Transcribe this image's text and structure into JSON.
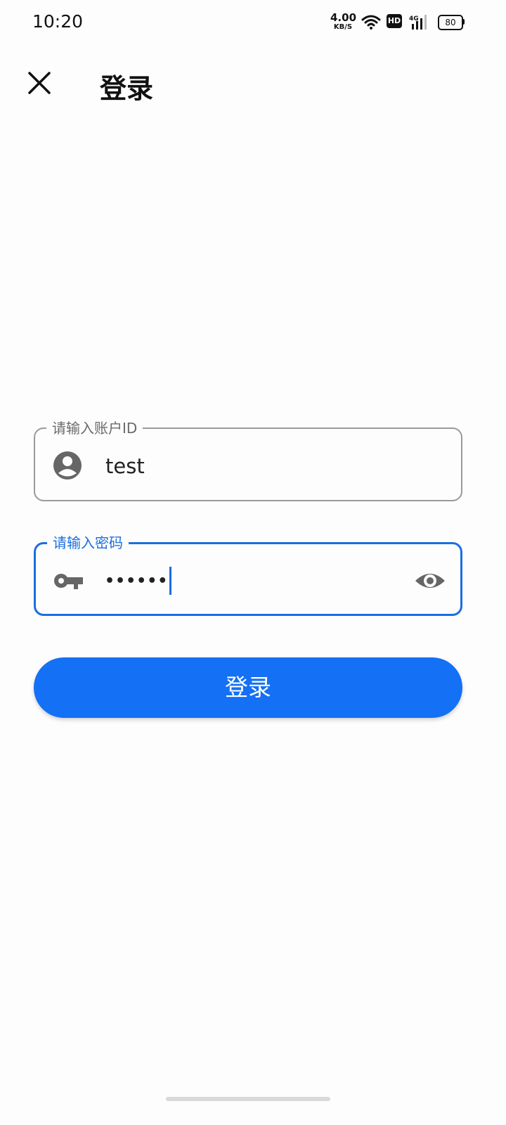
{
  "status_bar": {
    "time": "10:20",
    "net_speed_value": "4.00",
    "net_speed_unit": "KB/S",
    "hd_label": "HD",
    "network_label": "4G",
    "battery_level": "80"
  },
  "header": {
    "title": "登录",
    "close_icon": "close-icon"
  },
  "form": {
    "account": {
      "label": "请输入账户ID",
      "value": "test",
      "icon": "account-circle-icon"
    },
    "password": {
      "label": "请输入密码",
      "masked_value": "••••••",
      "icon": "key-icon",
      "toggle_icon": "eye-icon",
      "focused": true
    },
    "submit_label": "登录"
  },
  "colors": {
    "accent": "#1470f5",
    "focus_border": "#1a6fe0",
    "idle_border": "#9a9a9a",
    "background": "#fdfdfd"
  }
}
